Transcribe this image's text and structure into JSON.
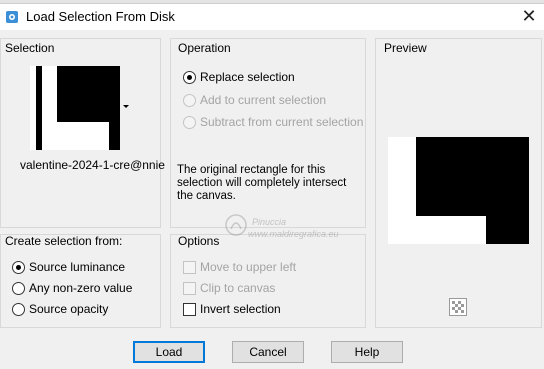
{
  "window": {
    "title": "Load Selection From Disk",
    "close_glyph": "✕"
  },
  "selection": {
    "heading": "Selection",
    "file_name": "valentine-2024-1-cre@nnie"
  },
  "operation": {
    "heading": "Operation",
    "options": [
      {
        "label": "Replace selection",
        "checked": true,
        "enabled": true
      },
      {
        "label": "Add to current selection",
        "checked": false,
        "enabled": false
      },
      {
        "label": "Subtract from current selection",
        "checked": false,
        "enabled": false
      }
    ],
    "message": "The original rectangle for this selection will completely intersect the canvas."
  },
  "preview": {
    "heading": "Preview"
  },
  "create_from": {
    "heading": "Create selection from:",
    "options": [
      {
        "label": "Source luminance",
        "checked": true
      },
      {
        "label": "Any non-zero value",
        "checked": false
      },
      {
        "label": "Source opacity",
        "checked": false
      }
    ]
  },
  "options": {
    "heading": "Options",
    "items": [
      {
        "label": "Move to upper left",
        "checked": false,
        "enabled": false
      },
      {
        "label": "Clip to canvas",
        "checked": false,
        "enabled": false
      },
      {
        "label": "Invert selection",
        "checked": false,
        "enabled": true
      }
    ]
  },
  "buttons": {
    "load": "Load",
    "cancel": "Cancel",
    "help": "Help"
  },
  "watermark": {
    "line1": "Pinuccia",
    "line2": "www.maldiregrafica.eu"
  },
  "colors": {
    "accent": "#0078d7",
    "panel_bg": "#f0f0f0",
    "selection_black": "#000000"
  }
}
